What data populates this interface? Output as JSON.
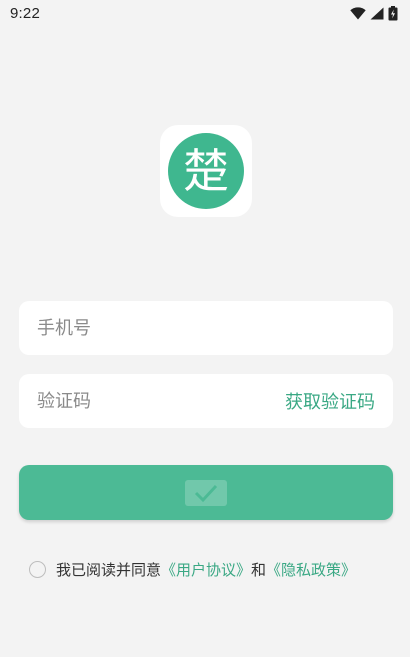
{
  "status_bar": {
    "time": "9:22",
    "icons": [
      "wifi-icon",
      "signal-icon",
      "battery-icon"
    ]
  },
  "logo": {
    "glyph": "楚",
    "accent_color": "#3fb78f"
  },
  "form": {
    "phone_placeholder": "手机号",
    "code_placeholder": "验证码",
    "get_code_label": "获取验证码"
  },
  "login_button": {
    "color": "#4cba95",
    "icon": "check-icon"
  },
  "agreement": {
    "prefix": "我已阅读并同意",
    "user_agreement": "《用户协议》",
    "conjunction": "和",
    "privacy_policy": "《隐私政策》"
  }
}
